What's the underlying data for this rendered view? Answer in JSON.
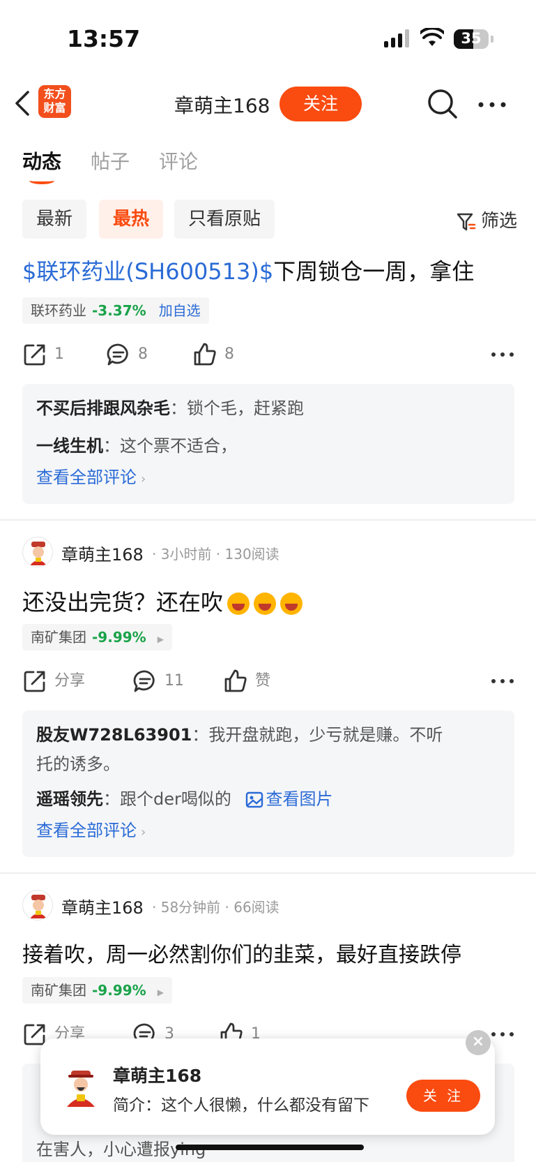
{
  "status": {
    "time": "13:57",
    "battery": "35"
  },
  "nav": {
    "logo_line1": "东方",
    "logo_line2": "财富",
    "title": "章萌主168",
    "follow": "关注"
  },
  "tabs": [
    {
      "label": "动态"
    },
    {
      "label": "帖子"
    },
    {
      "label": "评论"
    }
  ],
  "filters": {
    "chips": [
      "最新",
      "最热",
      "只看原贴"
    ],
    "filter": "筛选"
  },
  "posts": [
    {
      "stock_link": "$联环药业(SH600513)$",
      "text": "下周锁仓一周，拿住",
      "tag": {
        "name": "联环药业",
        "change": "-3.37%",
        "add": "加自选"
      },
      "actions": {
        "share": "1",
        "comment": "8",
        "like": "8"
      },
      "comments": [
        {
          "user": "不买后排跟风杂毛",
          "sep": "：",
          "text": "锁个毛，赶紧跑"
        },
        {
          "user": "一线生机",
          "sep": "：",
          "text": "这个票不适合，"
        }
      ],
      "see_all": "查看全部评论"
    },
    {
      "author": "章萌主168",
      "meta": "· 3小时前 · 130阅读",
      "text": "还没出完货？还在吹",
      "tag": {
        "name": "南矿集团",
        "change": "-9.99%"
      },
      "actions": {
        "share": "分享",
        "comment": "11",
        "like": "赞"
      },
      "comments": [
        {
          "user": "股友W728L63901",
          "sep": "：",
          "text": "我开盘就跑，少亏就是赚。不听",
          "text2": "托的诱多。"
        },
        {
          "user": "遥瑶领先",
          "sep": "：",
          "text": "跟个der喝似的",
          "pic": "查看图片"
        }
      ],
      "see_all": "查看全部评论"
    },
    {
      "author": "章萌主168",
      "meta": "· 58分钟前 · 66阅读",
      "text": "接着吹，周一必然割你们的韭菜，最好直接跌停",
      "tag": {
        "name": "南矿集团",
        "change": "-9.99%"
      },
      "actions": {
        "share": "分享",
        "comment": "3",
        "like": "1"
      },
      "partial_comment": "在害人，小心遭报ying"
    }
  ],
  "card": {
    "name": "章萌主168",
    "desc": "简介：这个人很懒，什么都没有留下",
    "follow": "关 注",
    "close": "×"
  },
  "colors": {
    "accent": "#fa4b10",
    "link": "#2a6bd6",
    "down": "#1aa34a"
  }
}
